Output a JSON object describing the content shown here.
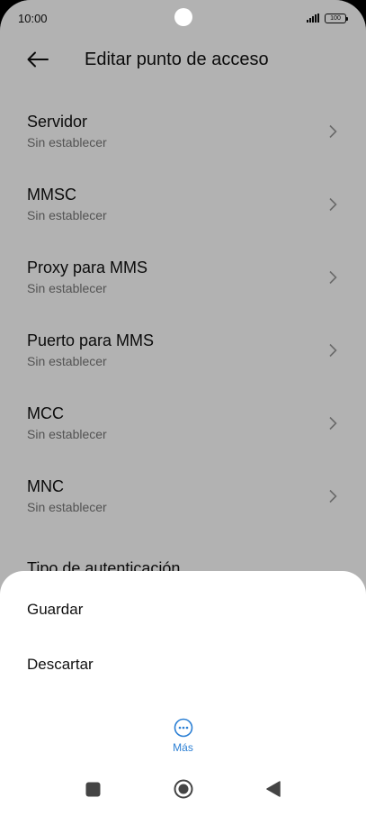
{
  "status_bar": {
    "time": "10:00",
    "battery": "100",
    "signal_icon": "signal-bars-icon"
  },
  "header": {
    "title": "Editar punto de acceso",
    "back_icon": "arrow-left-icon"
  },
  "settings": {
    "items": [
      {
        "title": "Servidor",
        "value": "Sin establecer"
      },
      {
        "title": "MMSC",
        "value": "Sin establecer"
      },
      {
        "title": "Proxy para MMS",
        "value": "Sin establecer"
      },
      {
        "title": "Puerto para MMS",
        "value": "Sin establecer"
      },
      {
        "title": "MCC",
        "value": "Sin establecer"
      },
      {
        "title": "MNC",
        "value": "Sin establecer"
      },
      {
        "title": "Tipo de autenticación",
        "value": ""
      }
    ]
  },
  "sheet": {
    "save_label": "Guardar",
    "discard_label": "Descartar",
    "more_label": "Más",
    "more_icon": "more-horizontal-icon"
  },
  "colors": {
    "accent": "#2b7fd4",
    "scrim": "rgba(0,0,0,0.30)"
  },
  "navbar": {
    "recents_icon": "square-icon",
    "home_icon": "circle-icon",
    "back_icon": "triangle-back-icon"
  }
}
